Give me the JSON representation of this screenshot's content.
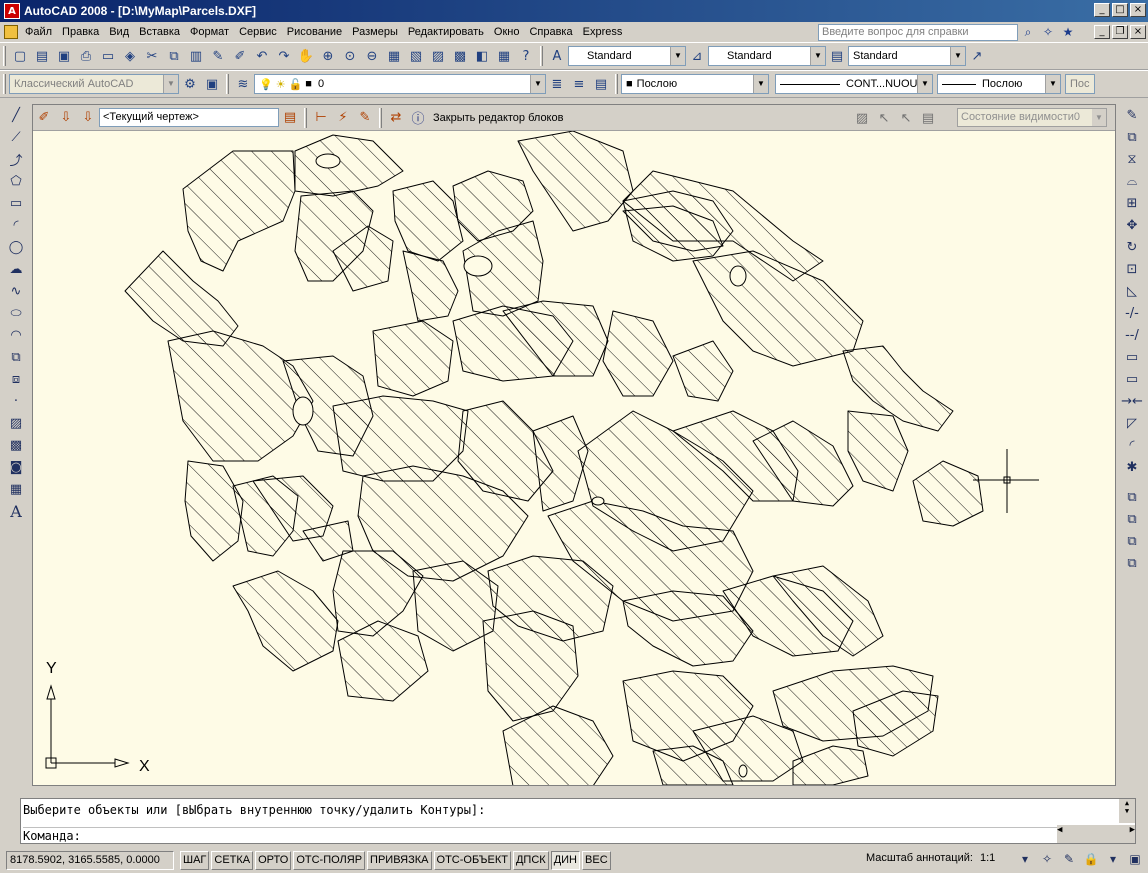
{
  "window": {
    "title": "AutoCAD 2008 - [D:\\MyMap\\Parcels.DXF]",
    "app_icon_text": "A"
  },
  "menu": {
    "items": [
      "Файл",
      "Правка",
      "Вид",
      "Вставка",
      "Формат",
      "Сервис",
      "Рисование",
      "Размеры",
      "Редактировать",
      "Окно",
      "Справка",
      "Express"
    ],
    "help_placeholder": "Введите вопрос для справки"
  },
  "toolbar1": {
    "text_style": "Standard",
    "dim_style": "Standard",
    "table_style": "Standard"
  },
  "toolbar2": {
    "workspace": "Классический AutoCAD",
    "layer": "0",
    "color": "Послою",
    "linetype": "CONT...NUOUS",
    "lineweight": "Послою",
    "plotstyle": "Пос"
  },
  "block_editor": {
    "current_drawing": "<Текущий чертеж>",
    "close_label": "Закрыть редактор блоков",
    "visibility_state": "Состояние видимости0"
  },
  "ucs": {
    "x_label": "X",
    "y_label": "Y"
  },
  "command": {
    "prompt_line": "Выберите объекты или [вЫбрать внутреннюю точку/удалить Контуры]:",
    "input_line": "Команда:"
  },
  "status": {
    "coordinates": "8178.5902, 3165.5585, 0.0000",
    "modes": [
      "ШАГ",
      "СЕТКА",
      "ОРТО",
      "ОТС-ПОЛЯР",
      "ПРИВЯЗКА",
      "ОТС-ОБЪЕКТ",
      "ДПСК",
      "ДИН",
      "ВЕС"
    ],
    "annotation_label": "Масштаб аннотаций:",
    "annotation_scale": "1:1"
  }
}
